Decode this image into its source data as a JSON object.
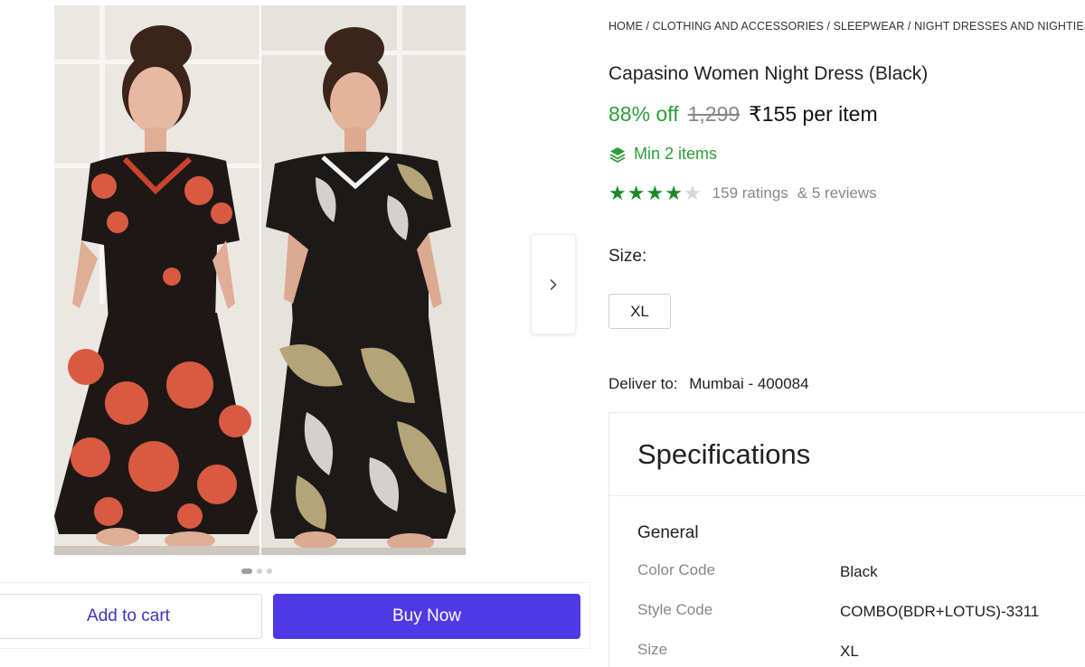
{
  "breadcrumb": {
    "items": [
      "HOME",
      "CLOTHING AND ACCESSORIES",
      "SLEEPWEAR",
      "NIGHT DRESSES AND NIGHTIES"
    ],
    "separator": "/"
  },
  "product": {
    "title": "Capasino Women Night Dress (Black)",
    "discount": "88% off",
    "mrp": "1,299",
    "price": "₹155 per item",
    "min_items": "Min 2 items",
    "rating_stars": 4,
    "rating_max": 5,
    "ratings_text": "159 ratings",
    "reviews_text": "& 5 reviews"
  },
  "size": {
    "label": "Size:",
    "options": [
      "XL"
    ]
  },
  "delivery": {
    "label": "Deliver to:",
    "value": "Mumbai - 400084"
  },
  "gallery": {
    "images": [
      {
        "name": "red-floral-nightdress-photo"
      },
      {
        "name": "black-lotus-nightdress-photo"
      }
    ],
    "dots": 3,
    "active_dot": 0
  },
  "actions": {
    "add_to_cart": "Add to cart",
    "buy_now": "Buy Now"
  },
  "specifications": {
    "title": "Specifications",
    "group": "General",
    "rows": [
      {
        "key": "Color Code",
        "value": "Black"
      },
      {
        "key": "Style Code",
        "value": "COMBO(BDR+LOTUS)-3311"
      },
      {
        "key": "Size",
        "value": "XL"
      }
    ]
  },
  "colors": {
    "accent": "#4f38e6",
    "discount_green": "#2d9d3a",
    "star_green": "#1c8a2e"
  }
}
